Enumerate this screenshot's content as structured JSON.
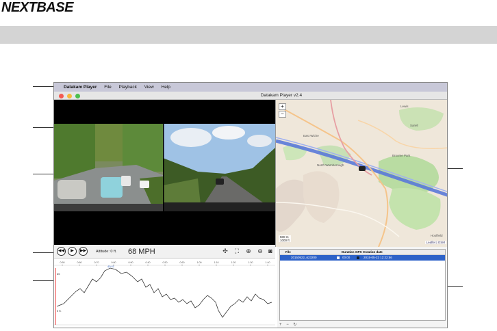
{
  "brand": {
    "logo_text": "NEXTBASE"
  },
  "menubar": {
    "app_name": "Datakam Player",
    "items": [
      "File",
      "Playback",
      "View",
      "Help"
    ]
  },
  "window": {
    "title": "Datakam Player  v2.4"
  },
  "controls": {
    "altitude_label": "Altitude: 0 ft.",
    "speed": "68 MPH"
  },
  "graph": {
    "ticks": [
      "0:50",
      "0:60",
      "0:70",
      "0:80",
      "0:90",
      "0:40",
      "0:50",
      "0:60",
      "1:00",
      "1:10",
      "1:20",
      "1:30",
      "1:40"
    ],
    "top_label": "40:41",
    "left_label_top": "65",
    "left_label_bottom": "5 ft."
  },
  "map": {
    "zoom_in": "+",
    "zoom_out": "−",
    "scale_km": "500 m",
    "scale_ft": "1000 ft",
    "attribution": "Leaflet | OSM",
    "places": [
      "East Wiche",
      "North Warnborough",
      "Broome Park",
      "Lewis",
      "Sarell",
      "Hoolfield"
    ]
  },
  "files": {
    "headers": {
      "file": "File",
      "duration": "Duration",
      "gps": "GPS",
      "created": "Creation date"
    },
    "rows": [
      {
        "file": "20150522_623200",
        "duration": "00:00",
        "created": "2015-05-22 12:22:56"
      }
    ],
    "bottom_buttons": [
      "+",
      "−",
      "↻"
    ]
  }
}
